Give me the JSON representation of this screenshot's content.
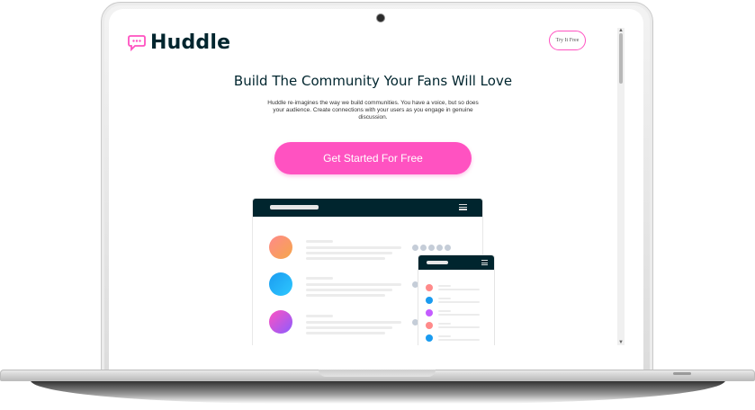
{
  "brand": {
    "name": "Huddle",
    "accent": "#ff52c1",
    "dark": "#00252e"
  },
  "header": {
    "try_button": "Try It Free"
  },
  "hero": {
    "headline": "Build The Community Your Fans Will Love",
    "description": "Huddle re-imagines the way we build communities. You have a voice, but so does your audience. Create connections with your users as you engage in genuine discussion.",
    "cta": "Get Started For Free"
  },
  "illustration": {
    "desktop_avatar_colors": [
      "#ff8a8a|#f5a64a",
      "#1a9bf0|#2ec8ff",
      "#ff52c1|#8c5cff"
    ],
    "mobile_avatar_colors": [
      "#ff8a8a",
      "#1a9bf0",
      "#c45cff",
      "#ff8a8a",
      "#1a9bf0"
    ]
  }
}
